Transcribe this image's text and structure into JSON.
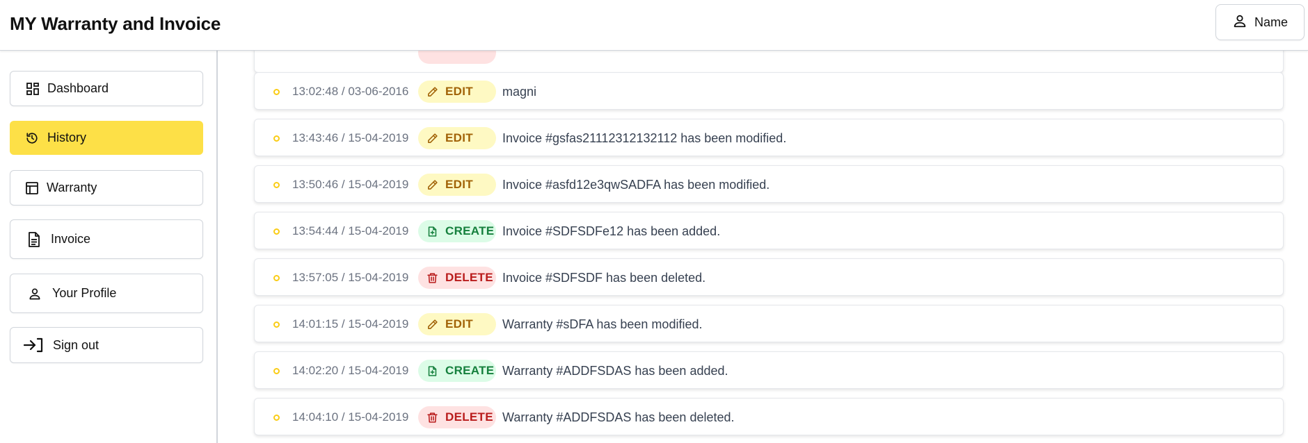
{
  "header": {
    "title": "MY Warranty and Invoice",
    "user_label": "Name"
  },
  "sidebar": {
    "items": [
      {
        "label": "Dashboard",
        "icon": "dashboard-icon",
        "active": false
      },
      {
        "label": "History",
        "icon": "history-icon",
        "active": true
      },
      {
        "label": "Warranty",
        "icon": "warranty-icon",
        "active": false
      },
      {
        "label": "Invoice",
        "icon": "document-icon",
        "active": false
      },
      {
        "label": "Your Profile",
        "icon": "user-icon",
        "active": false
      },
      {
        "label": "Sign out",
        "icon": "sign-out-icon",
        "active": false
      }
    ]
  },
  "colors": {
    "accent": "#fde047",
    "edit": "#a16207",
    "create": "#15803d",
    "delete": "#b91c1c"
  },
  "history": {
    "entries": [
      {
        "time": "13:02:48 / 03-06-2016",
        "action": "EDIT",
        "message": "magni"
      },
      {
        "time": "13:43:46 / 15-04-2019",
        "action": "EDIT",
        "message": "Invoice #gsfas21112312132112 has been modified."
      },
      {
        "time": "13:50:46 / 15-04-2019",
        "action": "EDIT",
        "message": "Invoice #asfd12e3qwSADFA has been modified."
      },
      {
        "time": "13:54:44 / 15-04-2019",
        "action": "CREATE",
        "message": "Invoice #SDFSDFe12 has been added."
      },
      {
        "time": "13:57:05 / 15-04-2019",
        "action": "DELETE",
        "message": "Invoice #SDFSDF has been deleted."
      },
      {
        "time": "14:01:15 / 15-04-2019",
        "action": "EDIT",
        "message": "Warranty #sDFA has been modified."
      },
      {
        "time": "14:02:20 / 15-04-2019",
        "action": "CREATE",
        "message": "Warranty #ADDFSDAS has been added."
      },
      {
        "time": "14:04:10 / 15-04-2019",
        "action": "DELETE",
        "message": "Warranty #ADDFSDAS has been deleted."
      }
    ]
  }
}
